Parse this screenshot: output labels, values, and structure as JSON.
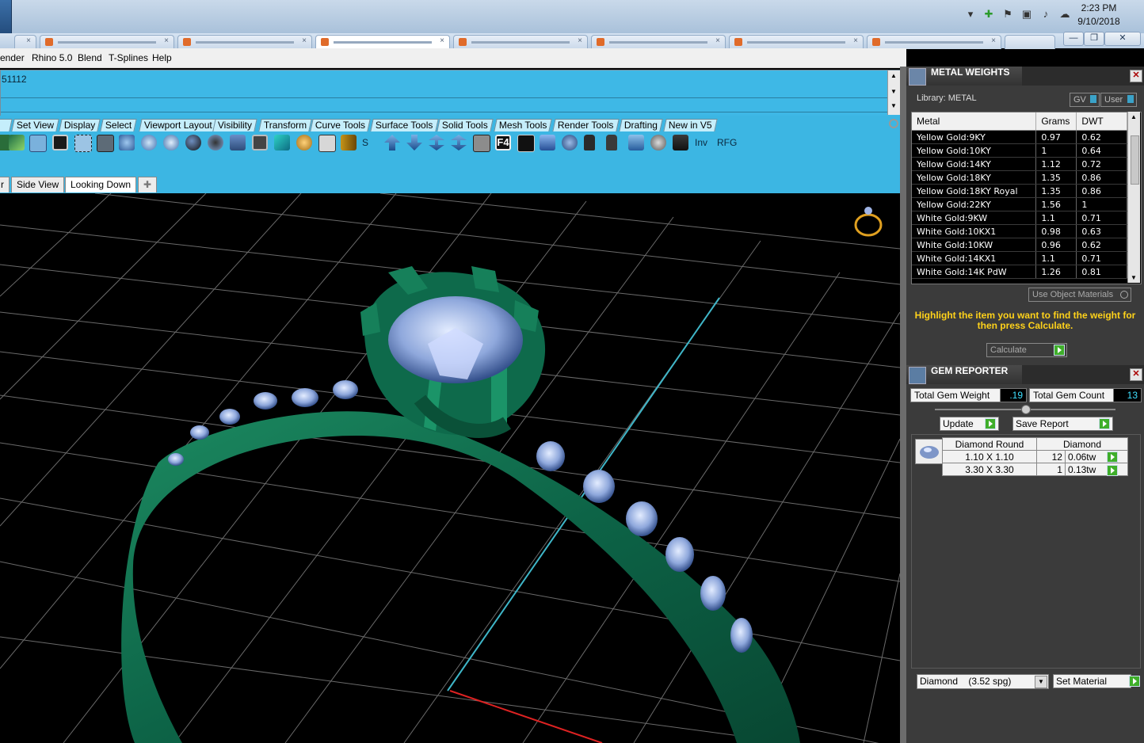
{
  "taskbar": {
    "time": "2:23 PM",
    "date": "9/10/2018"
  },
  "menu": [
    "ender",
    "Rhino 5.0",
    "Blend",
    "T-Splines",
    "Help"
  ],
  "command": {
    "history_line": "51112"
  },
  "toolbar_tabs": [
    "Set View",
    "Display",
    "Select",
    "Viewport Layout",
    "Visibility",
    "Transform",
    "Curve Tools",
    "Surface Tools",
    "Solid Tools",
    "Mesh Tools",
    "Render Tools",
    "Drafting",
    "New in V5"
  ],
  "toolbar_text": {
    "s_label": "S",
    "inv_label": "Inv",
    "rfg_label": "RFG"
  },
  "view_tabs": [
    "r",
    "Side View",
    "Looking Down"
  ],
  "metal_weights": {
    "title": "METAL WEIGHTS",
    "library_label": "Library: METAL",
    "gv_label": "GV",
    "user_label": "User",
    "columns": [
      "Metal",
      "Grams",
      "DWT"
    ],
    "rows": [
      [
        "Yellow Gold:9KY",
        "0.97",
        "0.62"
      ],
      [
        "Yellow Gold:10KY",
        "1",
        "0.64"
      ],
      [
        "Yellow Gold:14KY",
        "1.12",
        "0.72"
      ],
      [
        "Yellow Gold:18KY",
        "1.35",
        "0.86"
      ],
      [
        "Yellow Gold:18KY Royal",
        "1.35",
        "0.86"
      ],
      [
        "Yellow Gold:22KY",
        "1.56",
        "1"
      ],
      [
        "White Gold:9KW",
        "1.1",
        "0.71"
      ],
      [
        "White Gold:10KX1",
        "0.98",
        "0.63"
      ],
      [
        "White Gold:10KW",
        "0.96",
        "0.62"
      ],
      [
        "White Gold:14KX1",
        "1.1",
        "0.71"
      ],
      [
        "White Gold:14K PdW",
        "1.26",
        "0.81"
      ]
    ],
    "use_object_materials": "Use Object Materials",
    "hint": "Highlight the item you want to find the weight for then press Calculate.",
    "calculate_label": "Calculate"
  },
  "gem_reporter": {
    "title": "GEM REPORTER",
    "total_weight_label": "Total Gem Weight",
    "total_weight_value": ".19",
    "total_count_label": "Total Gem Count",
    "total_count_value": "13",
    "update_label": "Update",
    "save_report_label": "Save Report",
    "table_headers": [
      "Diamond Round",
      "Diamond"
    ],
    "gems": [
      {
        "size": "1.10 X 1.10",
        "count": "12",
        "weight": "0.06tw"
      },
      {
        "size": "3.30 X 3.30",
        "count": "1",
        "weight": "0.13tw"
      }
    ],
    "material_select": "Diamond    (3.52 spg)",
    "set_material_label": "Set Material"
  },
  "colors": {
    "command_blue": "#3eb8e6",
    "ring_green": "#0f6e4c",
    "gem_blue": "#8fa8dc",
    "hint_yellow": "#ffd21a",
    "value_cyan": "#3fe0ff"
  }
}
